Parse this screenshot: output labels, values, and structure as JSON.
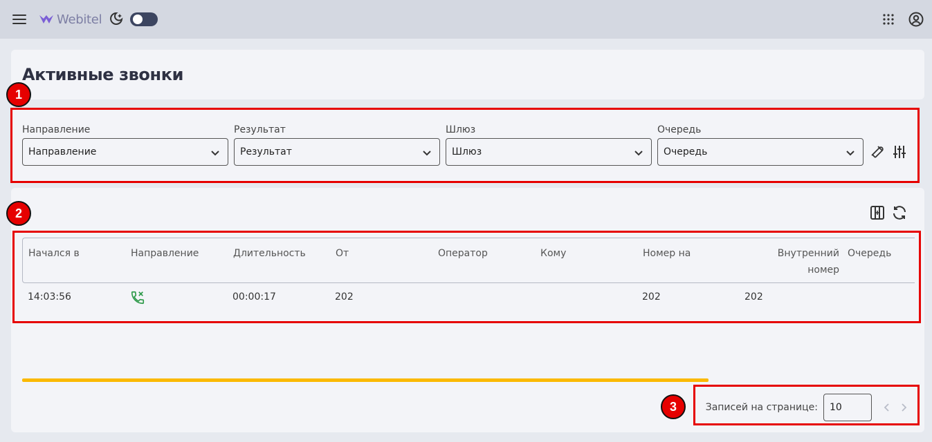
{
  "topbar": {
    "logo_text": "Webitel",
    "icons": [
      "menu-icon",
      "webitel-logo",
      "theme-moon-icon",
      "toggle",
      "apps-grid-icon",
      "account-circle-icon"
    ]
  },
  "page": {
    "title": "Активные звонки"
  },
  "filters": {
    "items": [
      {
        "label": "Направление",
        "value": "Направление"
      },
      {
        "label": "Результат",
        "value": "Результат"
      },
      {
        "label": "Шлюз",
        "value": "Шлюз"
      },
      {
        "label": "Очередь",
        "value": "Очередь"
      }
    ],
    "icons": [
      "clear-filters-icon",
      "filter-settings-icon"
    ]
  },
  "table": {
    "tools": [
      "column-select-icon",
      "refresh-icon"
    ],
    "headers": [
      "Начался в",
      "Направление",
      "Длительность",
      "От",
      "Оператор",
      "Кому",
      "Номер на",
      "Внутренний номер",
      "Очередь"
    ],
    "rows": [
      {
        "started": "14:03:56",
        "direction_icon": "call-missed-icon",
        "duration": "00:00:17",
        "from": "202",
        "operator": "",
        "to": "",
        "number": "202",
        "extension": "202",
        "queue": ""
      }
    ]
  },
  "progress": {
    "fraction": 0.77
  },
  "pagination": {
    "label": "Записей на странице:",
    "size": "10"
  },
  "annotations": [
    "1",
    "2",
    "3"
  ],
  "colors": {
    "annotation": "#e60000",
    "progress": "#fbb900",
    "call_icon": "#2e9a4a"
  }
}
